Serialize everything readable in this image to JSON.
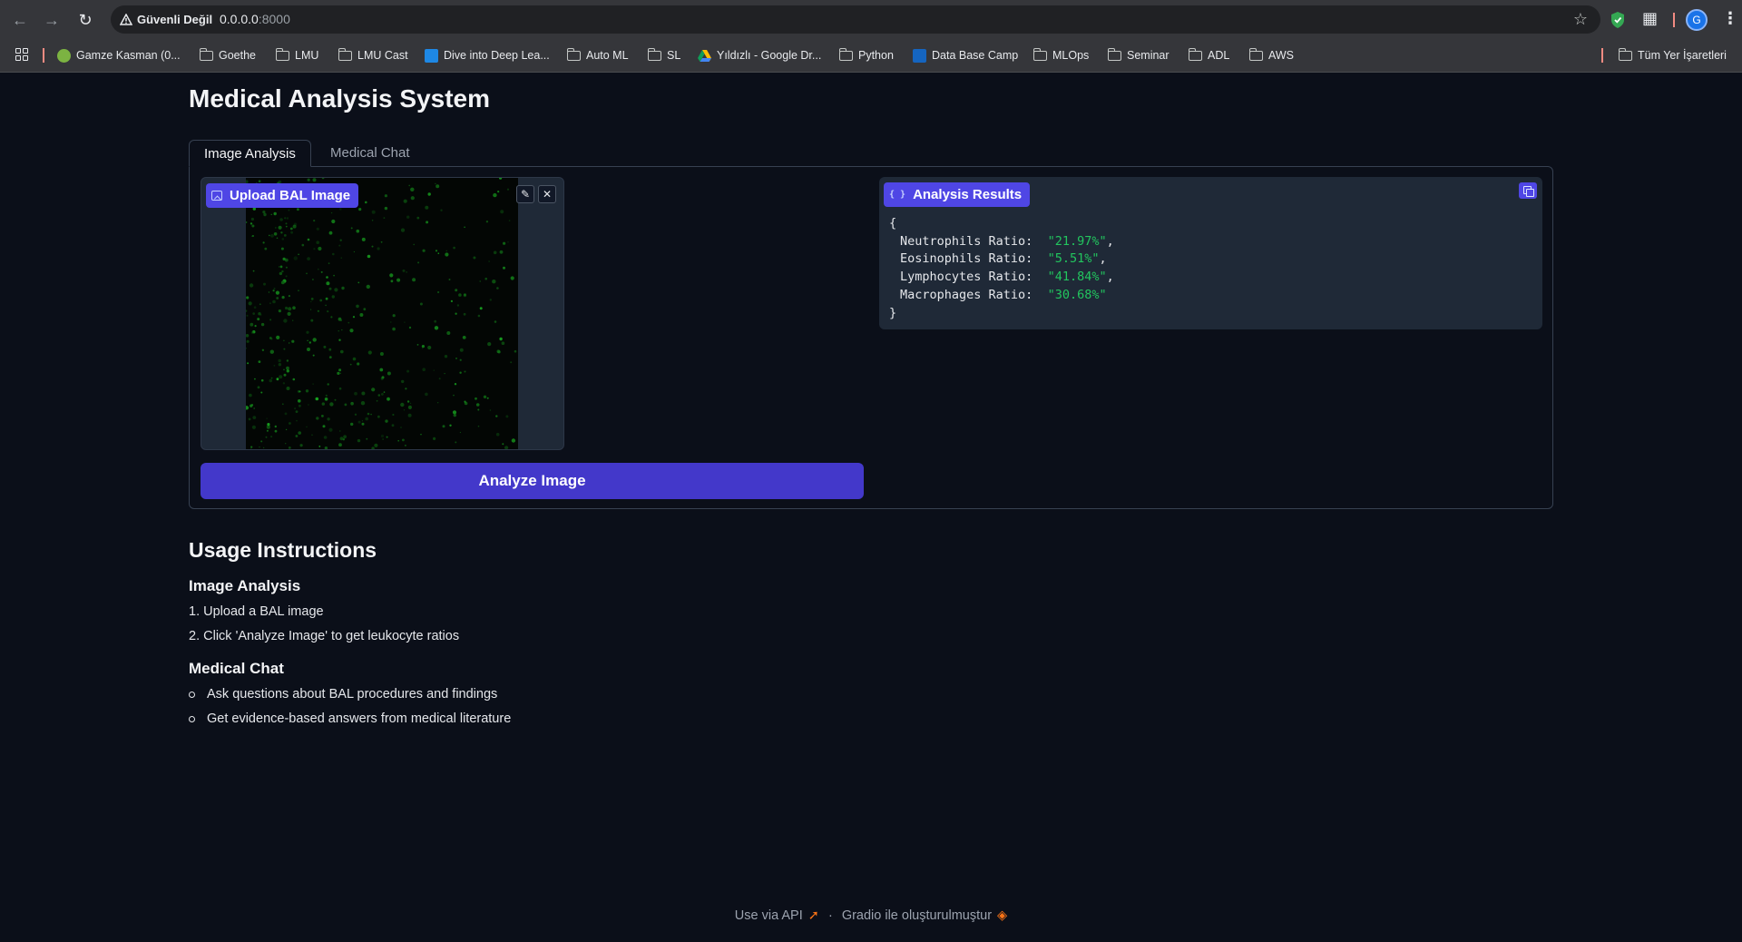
{
  "browser": {
    "security_label": "Güvenli Değil",
    "url_host": "0.0.0.0",
    "url_port": ":8000",
    "profile_initial": "G",
    "bookmarks": [
      {
        "label": "Gamze Kasman (0...",
        "icon": "profile-favicon"
      },
      {
        "label": "Goethe",
        "icon": "folder-icon"
      },
      {
        "label": "LMU",
        "icon": "folder-icon"
      },
      {
        "label": "LMU Cast",
        "icon": "folder-icon"
      },
      {
        "label": "Dive into Deep Lea...",
        "icon": "d2l-favicon"
      },
      {
        "label": "Auto ML",
        "icon": "folder-icon"
      },
      {
        "label": "SL",
        "icon": "folder-icon"
      },
      {
        "label": "Yıldızlı - Google Dr...",
        "icon": "google-drive-icon"
      },
      {
        "label": "Python",
        "icon": "folder-icon"
      },
      {
        "label": "Data Base Camp",
        "icon": "databasecamp-favicon"
      },
      {
        "label": "MLOps",
        "icon": "folder-icon"
      },
      {
        "label": "Seminar",
        "icon": "folder-icon"
      },
      {
        "label": "ADL",
        "icon": "folder-icon"
      },
      {
        "label": "AWS",
        "icon": "folder-icon"
      }
    ],
    "all_bookmarks_label": "Tüm Yer İşaretleri"
  },
  "app": {
    "title": "Medical Analysis System",
    "tabs": [
      {
        "label": "Image Analysis",
        "active": true
      },
      {
        "label": "Medical Chat",
        "active": false
      }
    ],
    "upload": {
      "label": "Upload BAL Image"
    },
    "analyze_button": "Analyze Image",
    "results": {
      "label": "Analysis Results",
      "open_brace": "{",
      "close_brace": "}",
      "entries": [
        {
          "key": "Neutrophils Ratio:",
          "value": "\"21.97%\"",
          "sep": ","
        },
        {
          "key": "Eosinophils Ratio:",
          "value": "\"5.51%\"",
          "sep": ","
        },
        {
          "key": "Lymphocytes Ratio:",
          "value": "\"41.84%\"",
          "sep": ","
        },
        {
          "key": "Macrophages Ratio:",
          "value": "\"30.68%\"",
          "sep": ""
        }
      ]
    }
  },
  "instructions": {
    "title": "Usage Instructions",
    "image_analysis": {
      "heading": "Image Analysis",
      "steps": [
        "1. Upload a BAL image",
        "2. Click 'Analyze Image' to get leukocyte ratios"
      ]
    },
    "medical_chat": {
      "heading": "Medical Chat",
      "items": [
        "Ask questions about BAL procedures and findings",
        "Get evidence-based answers from medical literature"
      ]
    }
  },
  "footer": {
    "api_label": "Use via API",
    "separator": "·",
    "built_with": "Gradio ile oluşturulmuştur"
  },
  "colors": {
    "background": "#0b0f19",
    "accent": "#4f46e5",
    "button": "#4338ca",
    "json_string": "#22c55e"
  }
}
